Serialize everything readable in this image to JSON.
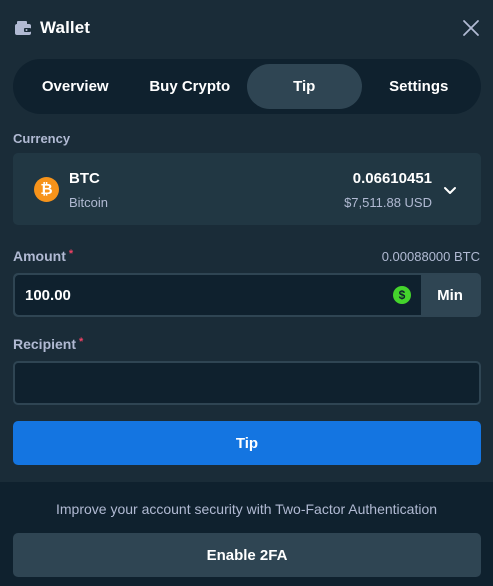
{
  "header": {
    "title": "Wallet",
    "icon": "wallet-icon",
    "close_icon": "close-icon"
  },
  "tabs": [
    {
      "label": "Overview",
      "active": false
    },
    {
      "label": "Buy Crypto",
      "active": false
    },
    {
      "label": "Tip",
      "active": true
    },
    {
      "label": "Settings",
      "active": false
    }
  ],
  "currency": {
    "label": "Currency",
    "code": "BTC",
    "name": "Bitcoin",
    "balance_crypto": "0.06610451",
    "balance_fiat": "$7,511.88 USD",
    "coin_symbol": "₿",
    "coin_color": "#f7931a"
  },
  "amount": {
    "label": "Amount",
    "required_mark": "*",
    "conversion": "0.00088000 BTC",
    "value": "100.00",
    "currency_symbol": "$",
    "min_label": "Min"
  },
  "recipient": {
    "label": "Recipient",
    "required_mark": "*",
    "value": ""
  },
  "tip_button": {
    "label": "Tip"
  },
  "footer": {
    "text": "Improve your account security with Two-Factor Authentication",
    "button_label": "Enable 2FA"
  },
  "colors": {
    "background": "#1a2c38",
    "panel_dark": "#0f212e",
    "panel": "#213743",
    "accent_blue": "#1475e1",
    "muted_text": "#b1bad3",
    "required": "#ed4163",
    "usd_green": "#44d42c"
  }
}
